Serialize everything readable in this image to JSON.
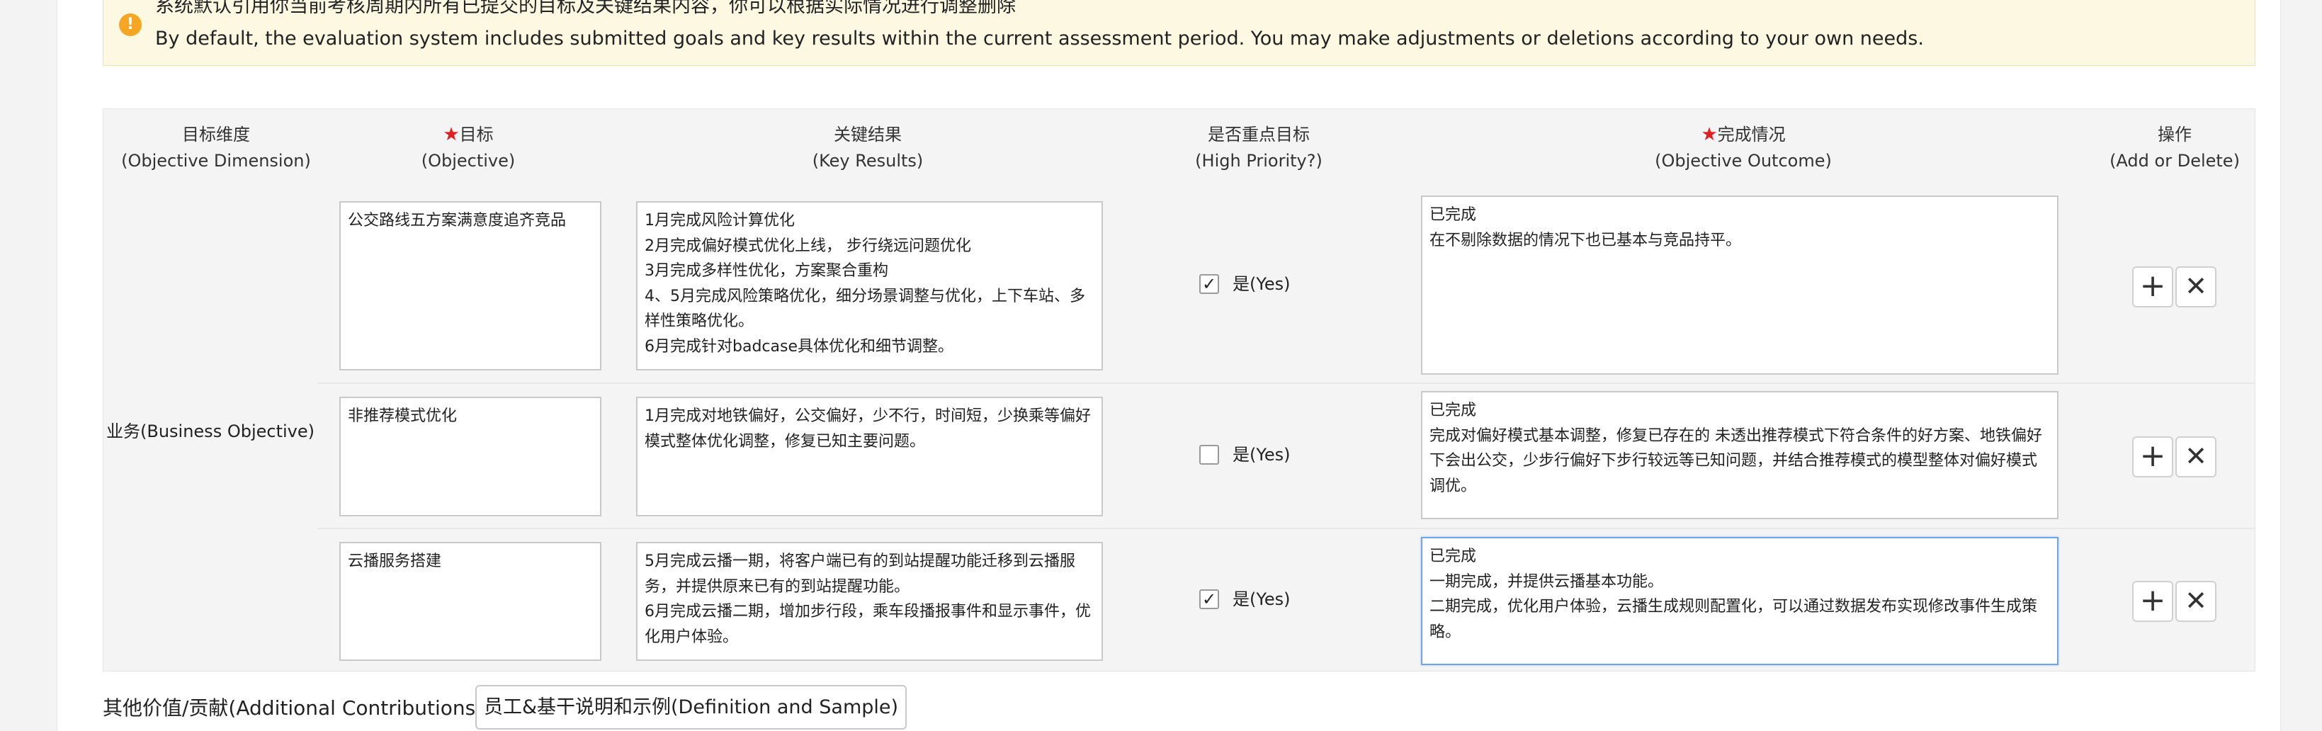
{
  "notice": {
    "icon": "warning-icon",
    "line_zh": "系统默认引用你当前考核周期内所有已提交的目标及关键结果内容，你可以根据实际情况进行调整删除",
    "line_en": "By default, the evaluation system includes submitted goals and key results within the current assessment period. You may make adjustments or deletions according to your own needs."
  },
  "table": {
    "headers": {
      "dimension": {
        "zh": "目标维度",
        "en": "(Objective Dimension)"
      },
      "objective": {
        "zh": "目标",
        "en": "(Objective)"
      },
      "key_results": {
        "zh": "关键结果",
        "en": "(Key Results)"
      },
      "priority": {
        "zh": "是否重点目标",
        "en": "(High Priority?)"
      },
      "outcome": {
        "zh": "完成情况",
        "en": "(Objective Outcome)"
      },
      "ops": {
        "zh": "操作",
        "en": "(Add or Delete)"
      }
    },
    "required_mark": "★",
    "dimension_label": "业务(Business Objective)",
    "rows": [
      {
        "objective": "公交路线五方案满意度追齐竞品",
        "key_results": "1月完成风险计算优化\n2月完成偏好模式优化上线， 步行绕远问题优化\n3月完成多样性优化，方案聚合重构\n4、5月完成风险策略优化，细分场景调整与优化，上下车站、多样性策略优化。\n6月完成针对badcase具体优化和细节调整。",
        "high_priority": true,
        "priority_label": "是(Yes)",
        "outcome": "已完成\n在不剔除数据的情况下也已基本与竞品持平。"
      },
      {
        "objective": "非推荐模式优化",
        "key_results": "1月完成对地铁偏好，公交偏好，少不行，时间短，少换乘等偏好模式整体优化调整，修复已知主要问题。",
        "high_priority": false,
        "priority_label": "是(Yes)",
        "outcome": "已完成\n完成对偏好模式基本调整，修复已存在的 未透出推荐模式下符合条件的好方案、地铁偏好下会出公交，少步行偏好下步行较远等已知问题，并结合推荐模式的模型整体对偏好模式调优。"
      },
      {
        "objective": "云播服务搭建",
        "key_results": "5月完成云播一期，将客户端已有的到站提醒功能迁移到云播服务，并提供原来已有的到站提醒功能。\n6月完成云播二期，增加步行段，乘车段播报事件和显示事件，优化用户体验。",
        "high_priority": true,
        "priority_label": "是(Yes)",
        "outcome": "已完成\n一期完成，并提供云播基本功能。\n二期完成，优化用户体验，云播生成规则配置化，可以通过数据发布实现修改事件生成策略。"
      }
    ],
    "add_symbol": "+",
    "delete_symbol": "✕"
  },
  "contributions": {
    "label": "其他价值/贡献(Additional Contributions)：",
    "button": "员工&基干说明和示例(Definition and Sample)"
  }
}
